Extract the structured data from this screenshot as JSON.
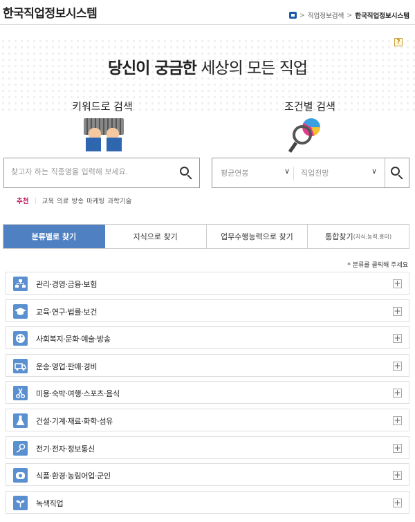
{
  "header": {
    "site_title": "한국직업정보시스템",
    "breadcrumb": [
      "직업정보검색",
      "한국직업정보시스템"
    ]
  },
  "hero": {
    "headline_bold": "당신이 궁금한",
    "headline_rest": "세상의 모든 직업",
    "help_icon": "?"
  },
  "keyword_search": {
    "title": "키워드로 검색",
    "placeholder": "찾고자 하는 직종명을 입력해 보세요."
  },
  "condition_search": {
    "title": "조건별 검색",
    "select_salary": "평균연봉",
    "select_outlook": "직업전망"
  },
  "recommend": {
    "label": "추천",
    "keywords": [
      "교육",
      "의료",
      "방송",
      "마케팅",
      "과학기술"
    ]
  },
  "tabs": [
    {
      "label": "분류별로 찾기",
      "active": true
    },
    {
      "label": "지식으로 찾기",
      "active": false
    },
    {
      "label": "업무수행능력으로 찾기",
      "active": false
    },
    {
      "label": "통합찾기",
      "sub": "(지식,능력,흥미)",
      "active": false
    }
  ],
  "hint": "* 분류를 클릭해 주세요",
  "categories": [
    {
      "label": "관리·경영·금융·보험",
      "icon": "org-chart-icon"
    },
    {
      "label": "교육·연구·법률·보건",
      "icon": "graduation-cap-icon"
    },
    {
      "label": "사회복지·문화·예술·방송",
      "icon": "palette-icon"
    },
    {
      "label": "운송·영업·판매·경비",
      "icon": "truck-icon"
    },
    {
      "label": "미용·숙박·여행·스포츠·음식",
      "icon": "scissors-icon"
    },
    {
      "label": "건설·기계·재료·화학·섬유",
      "icon": "flask-icon"
    },
    {
      "label": "전기·전자·정보통신",
      "icon": "plug-icon"
    },
    {
      "label": "식품·환경·농림어업·군인",
      "icon": "food-icon"
    },
    {
      "label": "녹색직업",
      "icon": "sprout-icon"
    }
  ],
  "colors": {
    "accent": "#4f80c2",
    "icon_bg": "#5a8fd0",
    "recommend_label": "#c2185b"
  }
}
